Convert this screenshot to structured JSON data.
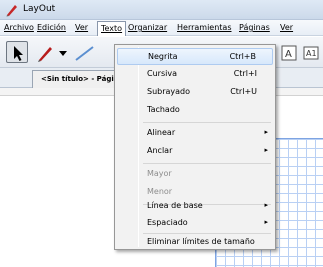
{
  "window": {
    "title": "LayOut",
    "icon": "layout-app-icon"
  },
  "menubar": {
    "items": [
      {
        "label": "Archivo"
      },
      {
        "label": "Edición"
      },
      {
        "label": "Ver"
      },
      {
        "label": "Texto"
      },
      {
        "label": "Organizar"
      },
      {
        "label": "Herramientas"
      },
      {
        "label": "Páginas"
      },
      {
        "label": "Ver"
      }
    ],
    "open_menu": "Texto"
  },
  "toolbar": {
    "tools": [
      "select-arrow-icon",
      "pencil-icon",
      "dropdown-arrow-icon",
      "line-icon",
      "text-icon",
      "label-icon"
    ]
  },
  "document_tab": {
    "label": "<Sin título> - Págin"
  },
  "text_menu": {
    "items": [
      {
        "label": "Negrita",
        "shortcut": "Ctrl+B",
        "highlighted": true
      },
      {
        "label": "Cursiva",
        "shortcut": "Ctrl+I"
      },
      {
        "label": "Subrayado",
        "shortcut": "Ctrl+U"
      },
      {
        "label": "Tachado",
        "shortcut": ""
      },
      {
        "label": "Alinear",
        "submenu": true
      },
      {
        "label": "Anclar",
        "submenu": true
      },
      {
        "label": "Mayor",
        "disabled": true
      },
      {
        "label": "Menor",
        "disabled": true
      },
      {
        "label": "Línea de base",
        "submenu": true
      },
      {
        "label": "Espaciado",
        "submenu": true
      },
      {
        "label": "Eliminar límites de tamaño"
      }
    ],
    "submenu_arrow": "▸"
  },
  "colors": {
    "highlight": "#d7e8fb",
    "grid_line": "#b9d0f4",
    "disabled_text": "#8d8d8d"
  }
}
